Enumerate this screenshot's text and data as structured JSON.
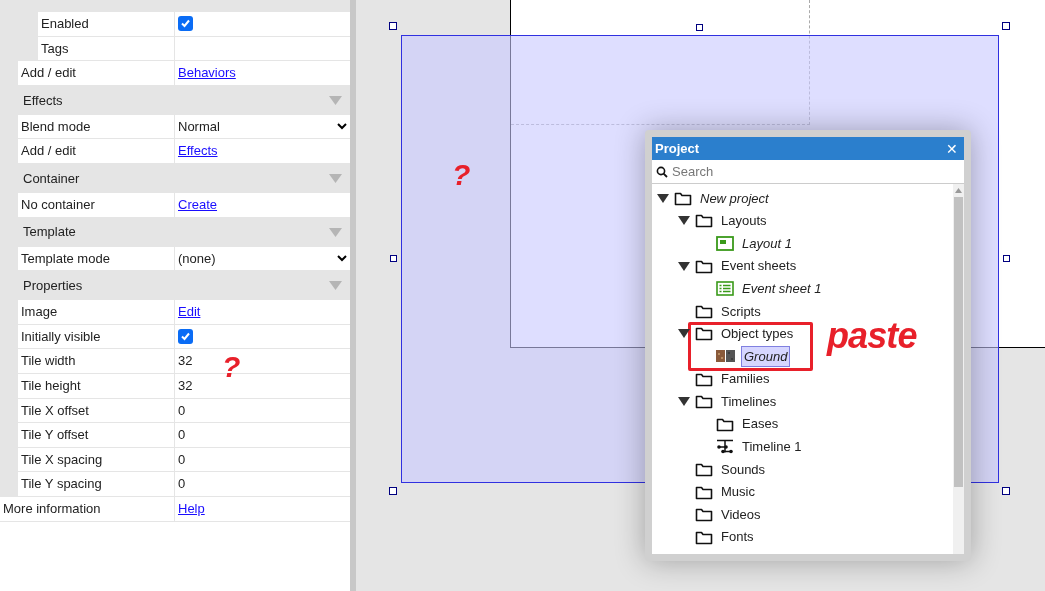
{
  "properties": [
    {
      "kind": "group",
      "children": [
        {
          "kind": "group",
          "children": [
            {
              "kind": "checkbox",
              "label": "Enabled",
              "checked": true
            },
            {
              "kind": "text",
              "label": "Tags"
            }
          ]
        },
        {
          "kind": "link",
          "label": "Add / edit",
          "value": "Behaviors"
        }
      ]
    },
    {
      "kind": "group",
      "title": "Effects",
      "children": [
        {
          "kind": "select",
          "label": "Blend mode",
          "value": "Normal"
        },
        {
          "kind": "link",
          "label": "Add / edit",
          "value": "Effects"
        }
      ]
    },
    {
      "kind": "group",
      "title": "Container",
      "children": [
        {
          "kind": "link",
          "label": "No container",
          "value": "Create"
        }
      ]
    },
    {
      "kind": "group",
      "title": "Template",
      "children": [
        {
          "kind": "select",
          "label": "Template mode",
          "value": "(none)"
        }
      ]
    },
    {
      "kind": "group",
      "title": "Properties",
      "children": [
        {
          "kind": "link",
          "label": "Image",
          "value": "Edit"
        },
        {
          "kind": "checkbox",
          "label": "Initially visible",
          "checked": true
        },
        {
          "kind": "text",
          "label": "Tile width",
          "value": "32"
        },
        {
          "kind": "text",
          "label": "Tile height",
          "value": "32"
        },
        {
          "kind": "text",
          "label": "Tile X offset",
          "value": "0"
        },
        {
          "kind": "text",
          "label": "Tile Y offset",
          "value": "0"
        },
        {
          "kind": "text",
          "label": "Tile X spacing",
          "value": "0"
        },
        {
          "kind": "text",
          "label": "Tile Y spacing",
          "value": "0"
        }
      ]
    },
    {
      "kind": "link",
      "label": "More information",
      "value": "Help"
    }
  ],
  "annotations": [
    "?",
    "?",
    "paste"
  ],
  "project_panel": {
    "title": "Project",
    "close": "✕",
    "search": {
      "placeholder": "Search"
    },
    "tree": [
      {
        "label": "New project",
        "kind": "folder",
        "italic": true,
        "expanded": true,
        "selected": false,
        "children": [
          {
            "label": "Layouts",
            "kind": "folder",
            "italic": false,
            "expanded": true,
            "selected": false,
            "children": [
              {
                "label": "Layout 1",
                "kind": "layout",
                "italic": true,
                "selected": false
              }
            ]
          },
          {
            "label": "Event sheets",
            "kind": "folder",
            "italic": false,
            "expanded": true,
            "selected": false,
            "children": [
              {
                "label": "Event sheet 1",
                "kind": "eventsheet",
                "italic": true,
                "selected": false
              }
            ]
          },
          {
            "label": "Scripts",
            "kind": "folder",
            "italic": false,
            "selected": false
          },
          {
            "label": "Object types",
            "kind": "folder",
            "italic": false,
            "expanded": true,
            "selected": false,
            "children": [
              {
                "label": "Ground",
                "kind": "sprite",
                "italic": true,
                "selected": true
              }
            ]
          },
          {
            "label": "Families",
            "kind": "folder",
            "italic": false,
            "selected": false
          },
          {
            "label": "Timelines",
            "kind": "folder",
            "italic": false,
            "expanded": true,
            "selected": false,
            "children": [
              {
                "label": "Eases",
                "kind": "folder",
                "italic": false,
                "selected": false
              },
              {
                "label": "Timeline 1",
                "kind": "timeline",
                "italic": false,
                "selected": false
              }
            ]
          },
          {
            "label": "Sounds",
            "kind": "folder",
            "italic": false,
            "selected": false
          },
          {
            "label": "Music",
            "kind": "folder",
            "italic": false,
            "selected": false
          },
          {
            "label": "Videos",
            "kind": "folder",
            "italic": false,
            "selected": false
          },
          {
            "label": "Fonts",
            "kind": "folder",
            "italic": false,
            "selected": false
          }
        ]
      }
    ]
  }
}
